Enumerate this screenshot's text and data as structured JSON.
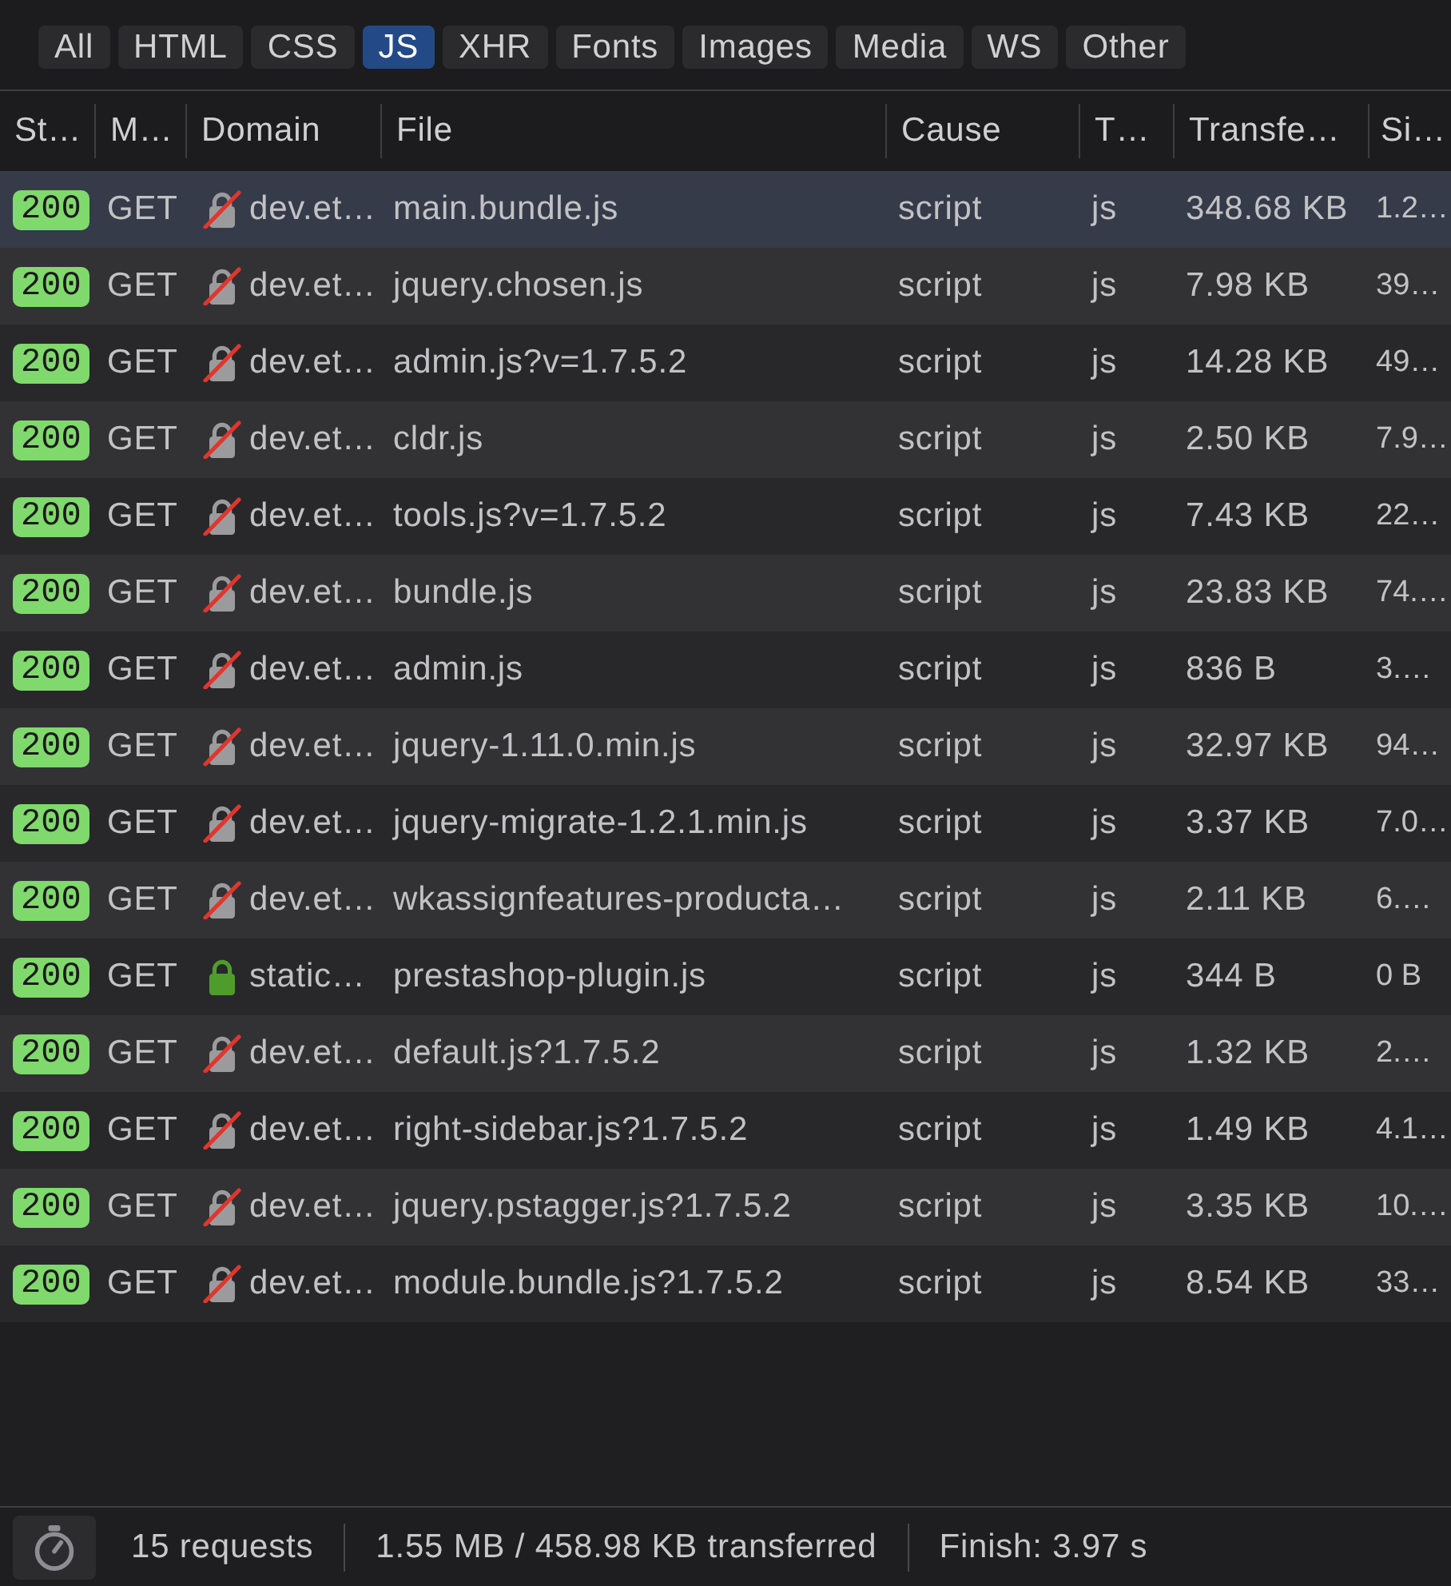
{
  "filters": [
    {
      "label": "All",
      "selected": false
    },
    {
      "label": "HTML",
      "selected": false
    },
    {
      "label": "CSS",
      "selected": false
    },
    {
      "label": "JS",
      "selected": true
    },
    {
      "label": "XHR",
      "selected": false
    },
    {
      "label": "Fonts",
      "selected": false
    },
    {
      "label": "Images",
      "selected": false
    },
    {
      "label": "Media",
      "selected": false
    },
    {
      "label": "WS",
      "selected": false
    },
    {
      "label": "Other",
      "selected": false
    }
  ],
  "columns": [
    "St…",
    "M…",
    "Domain",
    "File",
    "Cause",
    "T…",
    "Transfe…",
    "Si…"
  ],
  "rows": [
    {
      "status": "200",
      "method": "GET",
      "secure": false,
      "domain": "dev.et…",
      "file": "main.bundle.js",
      "cause": "script",
      "type": "js",
      "transferred": "348.68 KB",
      "size": "1.2…",
      "selected": true
    },
    {
      "status": "200",
      "method": "GET",
      "secure": false,
      "domain": "dev.et…",
      "file": "jquery.chosen.js",
      "cause": "script",
      "type": "js",
      "transferred": "7.98 KB",
      "size": "39…",
      "selected": false
    },
    {
      "status": "200",
      "method": "GET",
      "secure": false,
      "domain": "dev.et…",
      "file": "admin.js?v=1.7.5.2",
      "cause": "script",
      "type": "js",
      "transferred": "14.28 KB",
      "size": "49…",
      "selected": false
    },
    {
      "status": "200",
      "method": "GET",
      "secure": false,
      "domain": "dev.et…",
      "file": "cldr.js",
      "cause": "script",
      "type": "js",
      "transferred": "2.50 KB",
      "size": "7.9…",
      "selected": false
    },
    {
      "status": "200",
      "method": "GET",
      "secure": false,
      "domain": "dev.et…",
      "file": "tools.js?v=1.7.5.2",
      "cause": "script",
      "type": "js",
      "transferred": "7.43 KB",
      "size": "22…",
      "selected": false
    },
    {
      "status": "200",
      "method": "GET",
      "secure": false,
      "domain": "dev.et…",
      "file": "bundle.js",
      "cause": "script",
      "type": "js",
      "transferred": "23.83 KB",
      "size": "74.…",
      "selected": false
    },
    {
      "status": "200",
      "method": "GET",
      "secure": false,
      "domain": "dev.et…",
      "file": "admin.js",
      "cause": "script",
      "type": "js",
      "transferred": "836 B",
      "size": "3.…",
      "selected": false
    },
    {
      "status": "200",
      "method": "GET",
      "secure": false,
      "domain": "dev.et…",
      "file": "jquery-1.11.0.min.js",
      "cause": "script",
      "type": "js",
      "transferred": "32.97 KB",
      "size": "94…",
      "selected": false
    },
    {
      "status": "200",
      "method": "GET",
      "secure": false,
      "domain": "dev.et…",
      "file": "jquery-migrate-1.2.1.min.js",
      "cause": "script",
      "type": "js",
      "transferred": "3.37 KB",
      "size": "7.0…",
      "selected": false
    },
    {
      "status": "200",
      "method": "GET",
      "secure": false,
      "domain": "dev.et…",
      "file": "wkassignfeatures-producta…",
      "cause": "script",
      "type": "js",
      "transferred": "2.11 KB",
      "size": "6.…",
      "selected": false
    },
    {
      "status": "200",
      "method": "GET",
      "secure": true,
      "domain": "static…",
      "file": "prestashop-plugin.js",
      "cause": "script",
      "type": "js",
      "transferred": "344 B",
      "size": "0 B",
      "selected": false
    },
    {
      "status": "200",
      "method": "GET",
      "secure": false,
      "domain": "dev.et…",
      "file": "default.js?1.7.5.2",
      "cause": "script",
      "type": "js",
      "transferred": "1.32 KB",
      "size": "2.…",
      "selected": false
    },
    {
      "status": "200",
      "method": "GET",
      "secure": false,
      "domain": "dev.et…",
      "file": "right-sidebar.js?1.7.5.2",
      "cause": "script",
      "type": "js",
      "transferred": "1.49 KB",
      "size": "4.1…",
      "selected": false
    },
    {
      "status": "200",
      "method": "GET",
      "secure": false,
      "domain": "dev.et…",
      "file": "jquery.pstagger.js?1.7.5.2",
      "cause": "script",
      "type": "js",
      "transferred": "3.35 KB",
      "size": "10.…",
      "selected": false
    },
    {
      "status": "200",
      "method": "GET",
      "secure": false,
      "domain": "dev.et…",
      "file": "module.bundle.js?1.7.5.2",
      "cause": "script",
      "type": "js",
      "transferred": "8.54 KB",
      "size": "33…",
      "selected": false
    }
  ],
  "status_bar": {
    "requests": "15 requests",
    "transferred": "1.55 MB / 458.98 KB transferred",
    "finish": "Finish: 3.97 s"
  }
}
